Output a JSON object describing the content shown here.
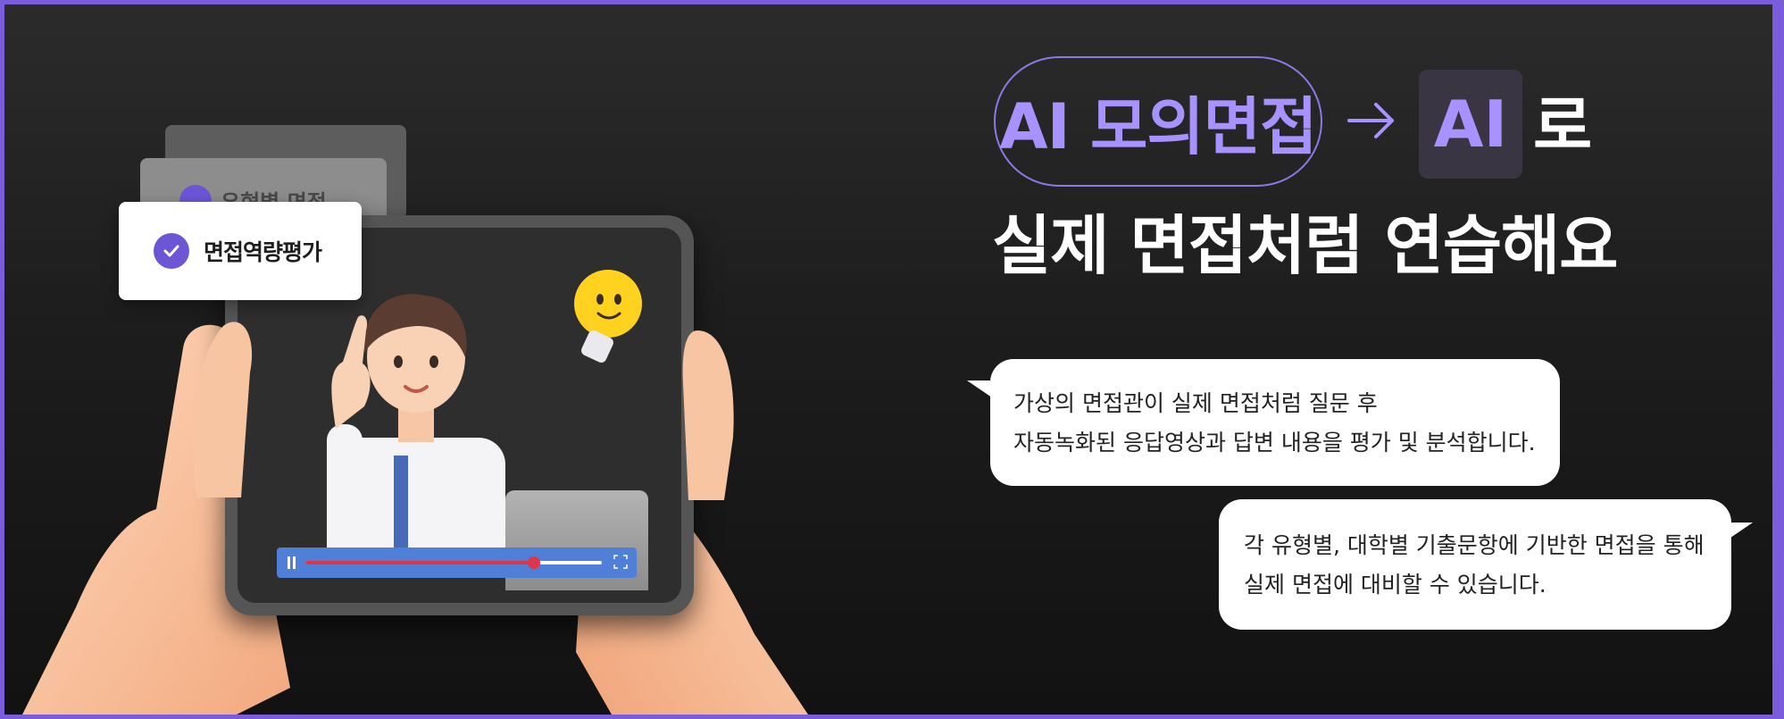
{
  "banner": {
    "pill_label": "AI 모의면접",
    "ai_box_label": "AI",
    "ro_label": "로",
    "headline_line2": "실제 면접처럼 연습해요",
    "accent_color": "#a892ff",
    "frame_color": "#7b5cdc"
  },
  "bubbles": [
    {
      "lines": [
        "가상의 면접관이 실제 면접처럼 질문 후",
        "자동녹화된 응답영상과 답변 내용을 평가 및 분석합니다."
      ]
    },
    {
      "lines": [
        "각 유형별, 대학별 기출문항에 기반한 면접을 통해",
        "실제 면접에 대비할 수 있습니다."
      ]
    }
  ],
  "cards": {
    "front_label": "면접역량평가",
    "back_label": "유형별 면접"
  },
  "video_player": {
    "progress": 0.77
  },
  "icons": [
    "arrow-right-icon",
    "check-icon",
    "pause-icon",
    "fullscreen-icon",
    "lightbulb-icon"
  ]
}
